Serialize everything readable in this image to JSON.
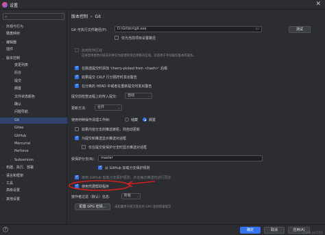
{
  "window": {
    "title": "设置",
    "close": "✕"
  },
  "sidebar": {
    "search_icon": "search-icon",
    "items": [
      {
        "label": "外观与行为",
        "arrow": "›",
        "indent": 0
      },
      {
        "label": "键盘映射",
        "arrow": "",
        "indent": 0
      },
      {
        "label": "编辑器",
        "arrow": "›",
        "indent": 0
      },
      {
        "label": "插件",
        "arrow": "",
        "indent": 0
      },
      {
        "label": "版本控制",
        "arrow": "⌄",
        "indent": 0
      },
      {
        "label": "变更列表",
        "arrow": "",
        "indent": 2
      },
      {
        "label": "后台",
        "arrow": "",
        "indent": 2
      },
      {
        "label": "提交",
        "arrow": "",
        "indent": 2
      },
      {
        "label": "搁置",
        "arrow": "",
        "indent": 2
      },
      {
        "label": "文件状态颜色",
        "arrow": "",
        "indent": 2
      },
      {
        "label": "确认",
        "arrow": "",
        "indent": 2
      },
      {
        "label": "问题导航",
        "arrow": "",
        "indent": 2
      },
      {
        "label": "Git",
        "arrow": "",
        "indent": 2,
        "selected": true
      },
      {
        "label": "Gitee",
        "arrow": "",
        "indent": 2
      },
      {
        "label": "GitHub",
        "arrow": "",
        "indent": 2
      },
      {
        "label": "Mercurial",
        "arrow": "",
        "indent": 2
      },
      {
        "label": "Perforce",
        "arrow": "",
        "indent": 2
      },
      {
        "label": "Subversion",
        "arrow": "›",
        "indent": 2
      },
      {
        "label": "构建、执行、部署",
        "arrow": "›",
        "indent": 0
      },
      {
        "label": "语言和框架",
        "arrow": "›",
        "indent": 0
      },
      {
        "label": "工具",
        "arrow": "›",
        "indent": 0
      },
      {
        "label": "高级设置",
        "arrow": "",
        "indent": 0
      },
      {
        "label": "其他设置",
        "arrow": "›",
        "indent": 0
      }
    ]
  },
  "breadcrumb": {
    "parent": "版本控制",
    "sep": "›",
    "current": "Git"
  },
  "git_path": {
    "label": "Git 可执行文件路径(P):",
    "value": "D:\\Git\\bin\\git.exe",
    "test_button": "测试",
    "project_only": "仅为当前项目设置路径"
  },
  "staging": {
    "label": "启用暂存区域",
    "hint": "这将禁用更改列表支持并仅为新建项目启用暂存区域，仅适用于手动操作版本库操作。"
  },
  "options": {
    "cherry_pick": "在挑选提交时添加 'cherry-picked from <hash>' 后缀",
    "crlf": "如果提交 CRLF 行分隔符时发出警告",
    "detached": "在分离的 HEAD 中或者在重新提交时发出警告"
  },
  "auto_fetch": {
    "label": "提交前检查远程上的传入提交:",
    "value": "自动"
  },
  "update": {
    "label": "更新方法:",
    "value": "合并"
  },
  "clean": {
    "label": "使用何种操作清理工作树:",
    "opt1": "储藏",
    "opt2": "搁置"
  },
  "push": {
    "auto_update": "如果内容分支的推送被拒，则自动更新",
    "preview": "为提交和推送显示推送对话框",
    "protected_only": "仅在提交受保护分支时显示推送对话框"
  },
  "protected": {
    "label": "受保护分支(B):",
    "value": "master",
    "github": "从 GitHub 加载分支保护规则"
  },
  "untracked": {
    "label": "使用 GitHub 加载分支保护规则，并在每次推送时进行同步"
  },
  "credential": {
    "label": "使用凭据帮助程序"
  },
  "filter": {
    "label": "按作者过滤（默认）信息:",
    "value": "所有"
  },
  "gpg": {
    "button": "配置 GPG 密钥...",
    "hint": "未配置用于提交签名的 GPG 密钥保留提交"
  },
  "footer": {
    "help": "?",
    "ok": "确定",
    "cancel": "取消",
    "apply": "应用(A)"
  },
  "watermark": "CSDN @CC阳1"
}
